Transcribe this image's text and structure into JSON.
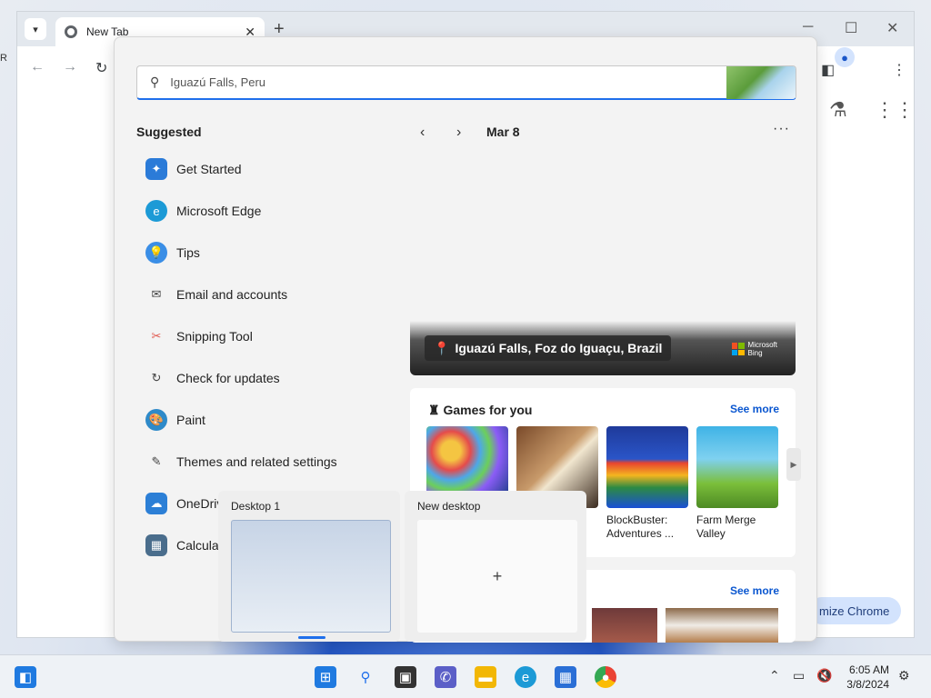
{
  "chrome": {
    "tab_title": "New Tab",
    "new_tab_symbol": "+",
    "customize_label": "mize Chrome"
  },
  "search": {
    "query": "Iguazú Falls, Peru"
  },
  "suggested": {
    "title": "Suggested",
    "apps": [
      {
        "label": "Get Started",
        "icon": "get-started-icon",
        "color": "#2b7bd8"
      },
      {
        "label": "Microsoft Edge",
        "icon": "edge-icon",
        "color": "#1c9ad6"
      },
      {
        "label": "Tips",
        "icon": "tips-icon",
        "color": "#3a8ee6"
      },
      {
        "label": "Email and accounts",
        "icon": "mail-icon",
        "color": "#444444"
      },
      {
        "label": "Snipping Tool",
        "icon": "scissors-icon",
        "color": "#e0564b"
      },
      {
        "label": "Check for updates",
        "icon": "refresh-icon",
        "color": "#444444"
      },
      {
        "label": "Paint",
        "icon": "paint-icon",
        "color": "#2e8ac9"
      },
      {
        "label": "Themes and related settings",
        "icon": "brush-icon",
        "color": "#444444"
      },
      {
        "label": "OneDriv",
        "icon": "onedrive-icon",
        "color": "#2c7fd6"
      },
      {
        "label": "Calculat",
        "icon": "calculator-icon",
        "color": "#4a6d8c"
      }
    ]
  },
  "date": {
    "label": "Mar 8"
  },
  "hero": {
    "location": "Iguazú Falls, Foz do Iguaçu, Brazil",
    "brand_line1": "Microsoft",
    "brand_line2": "Bing"
  },
  "games": {
    "title": "Games for you",
    "see_more": "See more",
    "items": [
      {
        "label": "",
        "icon": "bubble-shooter-thumb"
      },
      {
        "label": "",
        "icon": "chess-thumb"
      },
      {
        "label": "BlockBuster: Adventures ...",
        "icon": "blockbuster-thumb"
      },
      {
        "label": "Farm Merge Valley",
        "icon": "farm-merge-thumb"
      }
    ]
  },
  "card2": {
    "see_more": "See more"
  },
  "taskview": {
    "desktop1_label": "Desktop 1",
    "new_desktop_label": "New desktop",
    "add_symbol": "+"
  },
  "taskbar": {
    "time": "6:05 AM",
    "date": "3/8/2024"
  }
}
